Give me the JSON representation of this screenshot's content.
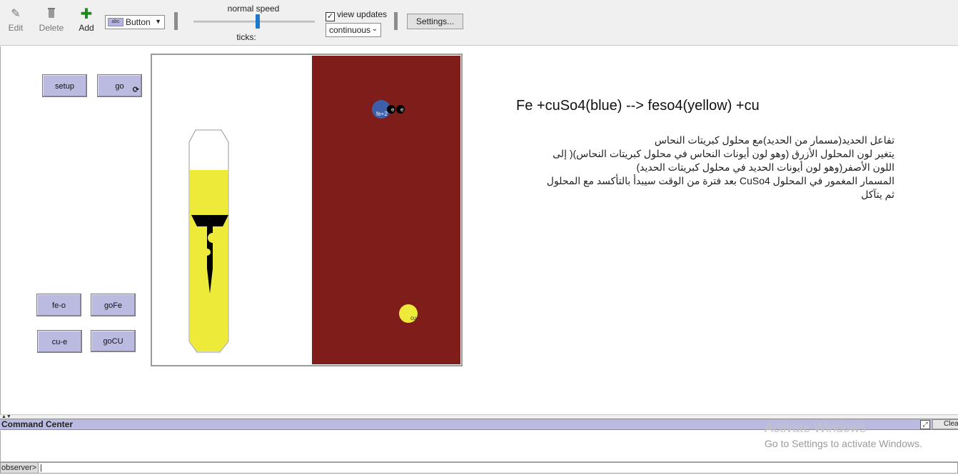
{
  "toolbar": {
    "edit_label": "Edit",
    "delete_label": "Delete",
    "add_label": "Add",
    "widget_type": "Button",
    "widget_icon_text": "abc",
    "speed_label": "normal speed",
    "speed_value": 0.5,
    "ticks_label": "ticks:",
    "view_updates_label": "view updates",
    "view_updates_checked": true,
    "update_mode": "continuous",
    "settings_label": "Settings..."
  },
  "buttons": {
    "setup": "setup",
    "go": "go",
    "fe_o": "fe-o",
    "go_fe": "goFe",
    "cu_e": "cu-e",
    "go_cu": "goCU"
  },
  "world": {
    "colors": {
      "solution": "#7f1d1a",
      "liquid": "#eeea3a",
      "background": "#ffffff",
      "fe_ion": "#3d5fa8",
      "cu_atom": "#eeea3a",
      "electron": "#000000"
    },
    "fe_ion_label": "fe+2",
    "electron_label": "e",
    "cu_label": "cu"
  },
  "info": {
    "equation": "Fe +cuSo4(blue) --> feso4(yellow) +cu",
    "lines": [
      "تفاعل الحديد(مسمار من الحديد)مع محلول كبريتات النحاس",
      "يتغير لون المحلول الأزرق (وهو لون أيونات النحاس في محلول كبريتات النحاس)( إلى",
      "اللون الأصفر(وهو لون أيونات الحديد في محلول كبريتات الحديد)",
      "المسمار المغمور في المحلول CuSo4 بعد فترة من الوقت سيبدأ بالتأكسد مع المحلول",
      "ثم يتآكل"
    ]
  },
  "command_center": {
    "title": "Command Center",
    "clear_label": "Clear",
    "prompt": "observer>",
    "input_value": "",
    "watermark_line1": "Activate Windows",
    "watermark_line2": "Go to Settings to activate Windows."
  }
}
